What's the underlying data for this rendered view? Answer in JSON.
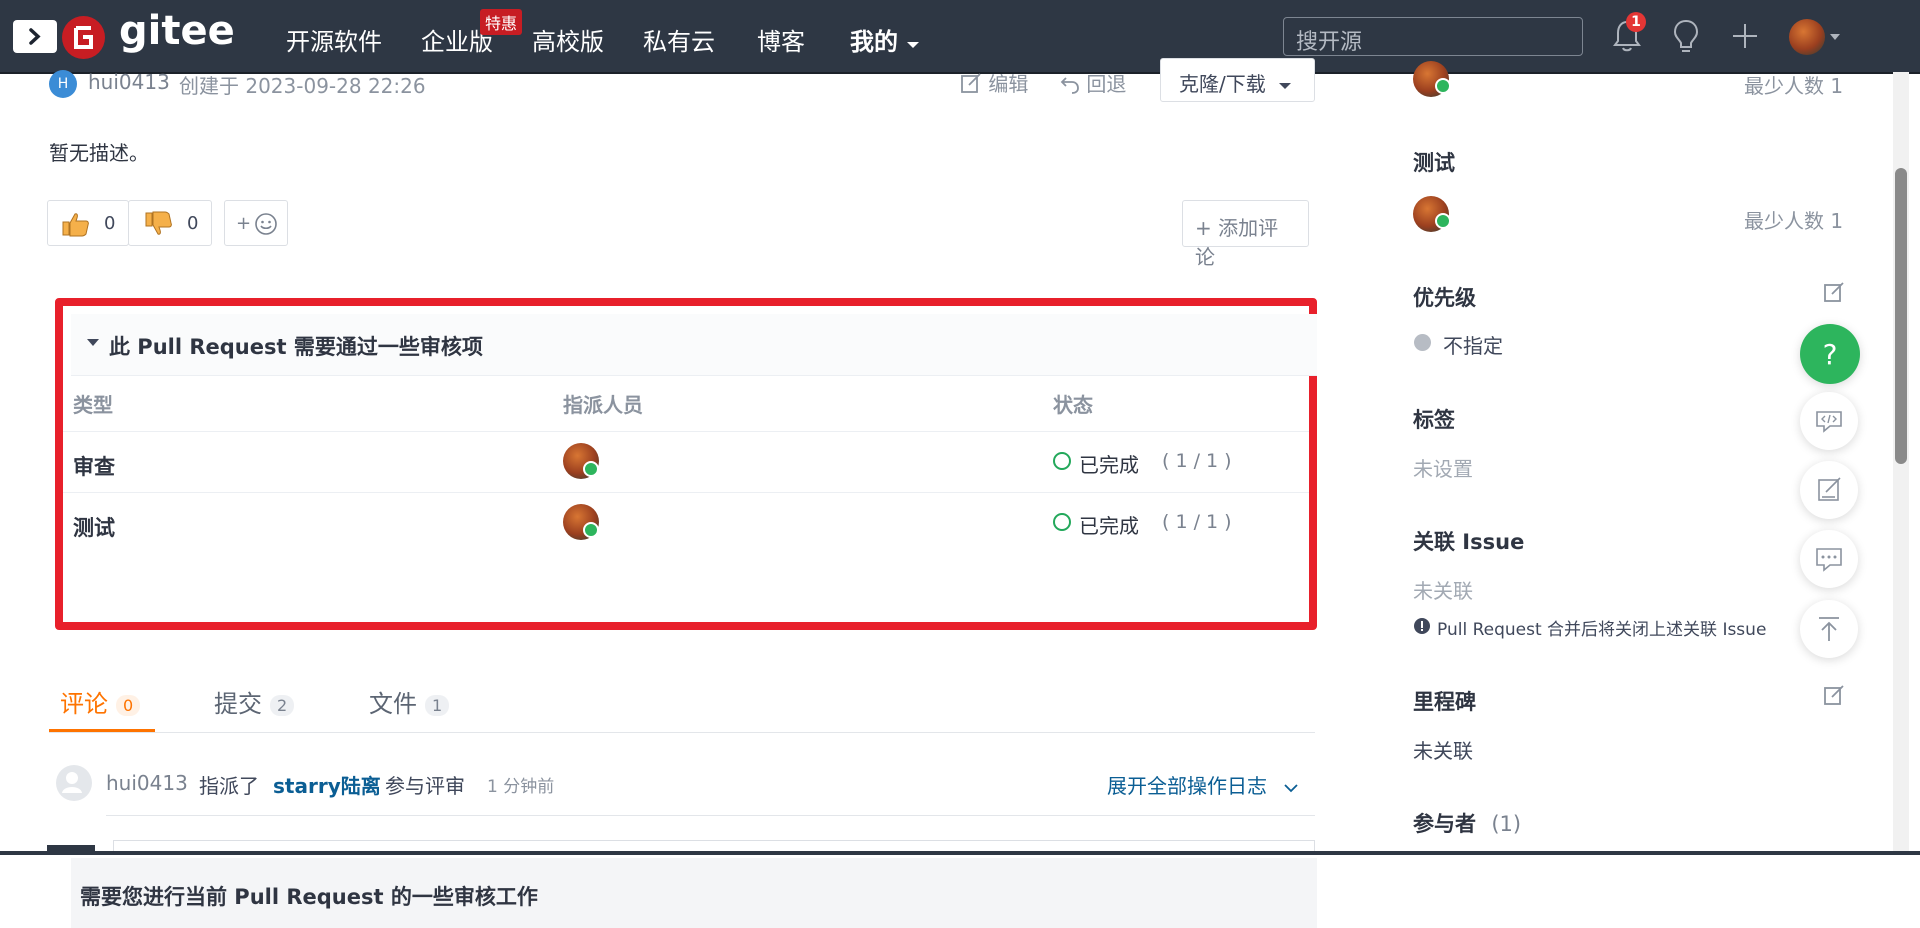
{
  "nav": {
    "logo": "gitee",
    "items": [
      "开源软件",
      "企业版",
      "高校版",
      "私有云",
      "博客",
      "我的"
    ],
    "promo": "特惠",
    "search_placeholder": "搜开源",
    "notification_count": "1"
  },
  "pr": {
    "author_initial": "H",
    "author": "hui0413",
    "created": "创建于 2023-09-28 22:26",
    "edit": "编辑",
    "revert": "回退",
    "clone": "克隆/下载",
    "description": "暂无描述。",
    "likes": "0",
    "dislikes": "0",
    "emoji_add": "+",
    "add_comment": "+ 添加评论"
  },
  "review": {
    "title": "此 Pull Request 需要通过一些审核项",
    "headers": [
      "类型",
      "指派人员",
      "状态"
    ],
    "rows": [
      {
        "type": "审查",
        "status": "已完成",
        "progress": "( 1 / 1 )"
      },
      {
        "type": "测试",
        "status": "已完成",
        "progress": "( 1 / 1 )"
      }
    ],
    "footer": "需要您进行当前 Pull Request 的一些审核工作"
  },
  "tabs": [
    {
      "label": "评论",
      "count": "0",
      "active": true
    },
    {
      "label": "提交",
      "count": "2",
      "active": false
    },
    {
      "label": "文件",
      "count": "1",
      "active": false
    }
  ],
  "activity": {
    "user": "hui0413",
    "action": "指派了",
    "target": "starry陆离",
    "action2": "参与评审",
    "time": "1 分钟前",
    "expand": "展开全部操作日志"
  },
  "sidebar": {
    "min_reviewers_top": "最少人数 1",
    "test_title": "测试",
    "min_testers": "最少人数 1",
    "priority_title": "优先级",
    "priority_value": "不指定",
    "labels_title": "标签",
    "labels_value": "未设置",
    "issue_title": "关联 Issue",
    "issue_value": "未关联",
    "issue_note": "Pull Request 合并后将关闭上述关联 Issue",
    "milestone_title": "里程碑",
    "milestone_value": "未关联",
    "participants_title": "参与者",
    "participants_count": "(1)"
  },
  "colors": {
    "nav_bg": "#2e3744",
    "brand": "#c71d23",
    "highlight_border": "#e8202b",
    "active_tab": "#fe7300",
    "success": "#23a85b",
    "help": "#2db55d"
  }
}
